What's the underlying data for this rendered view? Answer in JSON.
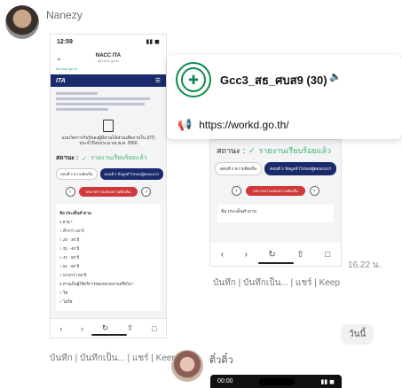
{
  "message1": {
    "sender": "Nanezy",
    "actions": "บันทึก | บันทึกเป็น... | แชร์ | Keep",
    "screenshot": {
      "status_time": "12:59",
      "status_icons": "▮▮ ◼",
      "app_title": "NACC ITA",
      "app_subtitle": "ita.nacc.go.th",
      "url": "ita.nacc.go.th",
      "brand": "ITA",
      "menu_icon": "menu-icon",
      "heading": "แบบวัดการรับรู้ของผู้มีส่วนได้ส่วนเสียภายใน (IIT) ประจำปีงบประมาณ พ.ศ. 2566",
      "status_label": "สถานะ :",
      "status_value": "รายงานเรียบร้อยแล้ว",
      "tabs": [
        "ตอนที่ 2 ความคิดเห็น",
        "ตอนที่ 3 ข้อมูลทั่วไปของผู้ตอบแบบฯ"
      ],
      "pager_button": "บทบาทการแสดงความคิดเห็น",
      "card_title": "ข้อ ประเด็นคำถาม",
      "card_rows": [
        "1 อายุ *",
        "○ ต่ำกว่า 20 ปี",
        "○ 20 - 30 ปี",
        "○ 31 - 40 ปี",
        "○ 41 - 50 ปี",
        "○ 51 - 60 ปี",
        "○ มากกว่า 60 ปี",
        "2 ท่านเป็นผู้ใช้บริการของหน่วยงานหรือไม่ *",
        "○ ใช่",
        "○ ไม่ใช่"
      ],
      "nav": [
        "‹",
        "›",
        "↻",
        "⇧",
        "□"
      ]
    }
  },
  "group_card": {
    "name": "Gcc3_สธ_ศบส9 (30)",
    "speaker_icon": "speaker-icon",
    "link": "https://workd.go.th/",
    "logo_icon": "ministry-of-public-health-logo"
  },
  "message2_screenshot": {
    "status_label": "สถานะ :",
    "status_value": "รายงานเรียบร้อยแล้ว",
    "tabs": [
      "ตอนที่ 2 ความคิดเห็น",
      "ตอนที่ 3 ข้อมูลทั่วไปของผู้ตอบแบบฯ"
    ],
    "pager_button": "บทบาทการแสดงความคิดเห็น",
    "card_title": "ข้อ ประเด็นคำถาม",
    "nav": [
      "‹",
      "›",
      "↻",
      "⇧",
      "□"
    ],
    "time": "16.22 น.",
    "actions": "บันทึก | บันทึกเป็น... | แชร์ | Keep"
  },
  "date_chip": "วันนี้",
  "message3": {
    "sender": "ติ๋วติ๋ว",
    "status_time": "00:00",
    "status_icons": "▮▮ ◼"
  }
}
